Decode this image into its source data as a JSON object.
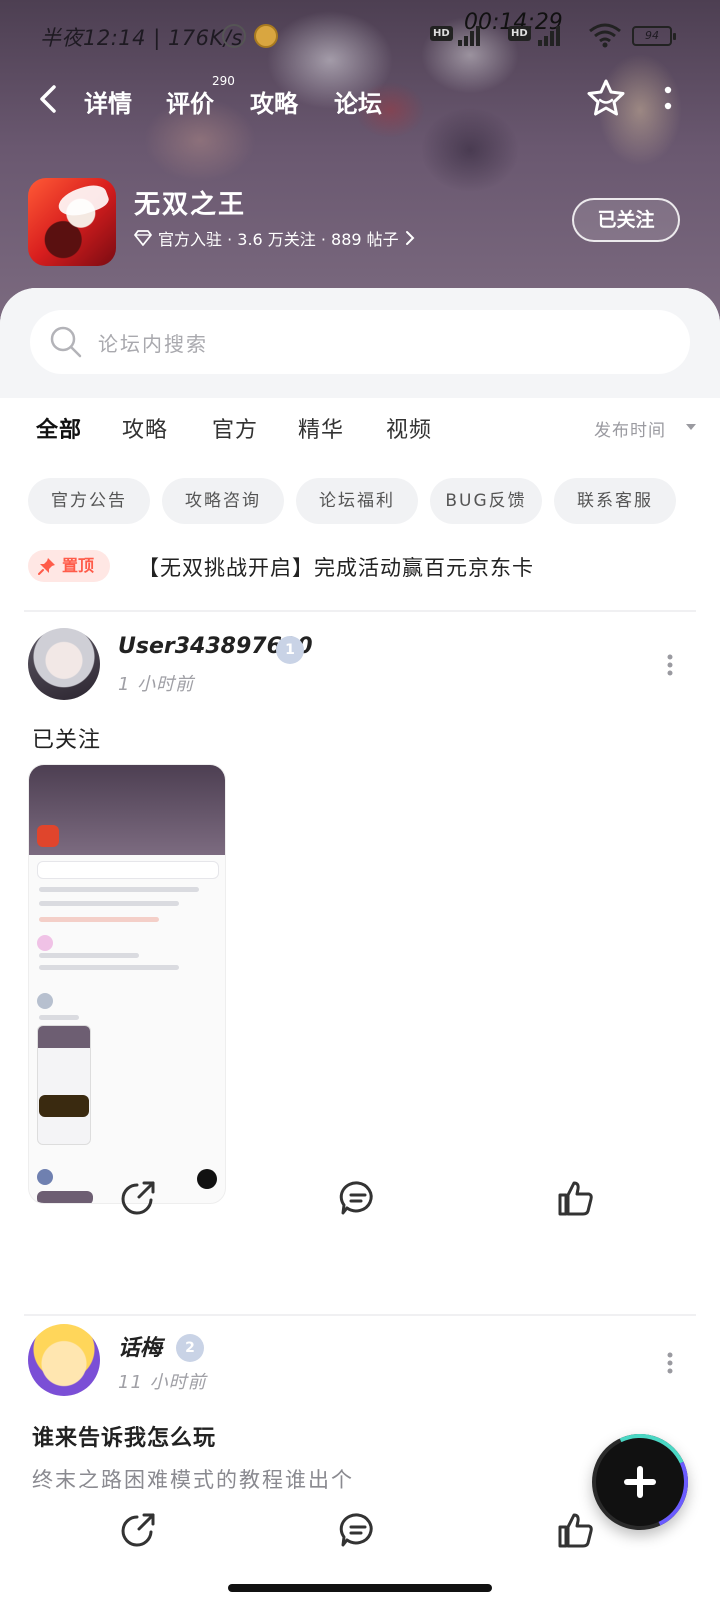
{
  "status_bar": {
    "left_text": "半夜12:14 | 176K/s",
    "time": "00:14:29",
    "battery": "94"
  },
  "top_nav": {
    "tabs": [
      {
        "label": "详情"
      },
      {
        "label": "评价",
        "badge": "290"
      },
      {
        "label": "攻略"
      },
      {
        "label": "论坛"
      }
    ],
    "active_tab": "论坛"
  },
  "game": {
    "name": "无双之王",
    "meta": "官方入驻 · 3.6 万关注 · 889 帖子",
    "follow_label": "已关注"
  },
  "search": {
    "placeholder": "论坛内搜索"
  },
  "categories": {
    "items": [
      "全部",
      "攻略",
      "官方",
      "精华",
      "视频"
    ],
    "active": "全部",
    "sort_label": "发布时间"
  },
  "chips": [
    "官方公告",
    "攻略咨询",
    "论坛福利",
    "BUG反馈",
    "联系客服"
  ],
  "pinned": {
    "tag": "置顶",
    "title": "【无双挑战开启】完成活动赢百元京东卡"
  },
  "posts": [
    {
      "username": "User343897600",
      "level": "1",
      "time": "1 小时前",
      "text": "已关注"
    },
    {
      "username": "话梅",
      "level": "2",
      "time": "11 小时前",
      "title": "谁来告诉我怎么玩",
      "subtitle": "终末之路困难模式的教程谁出个"
    }
  ],
  "colors": {
    "accent": "#2fd9b6",
    "pinned": "#ff5c4a",
    "header_bg": "#5a4a60"
  }
}
